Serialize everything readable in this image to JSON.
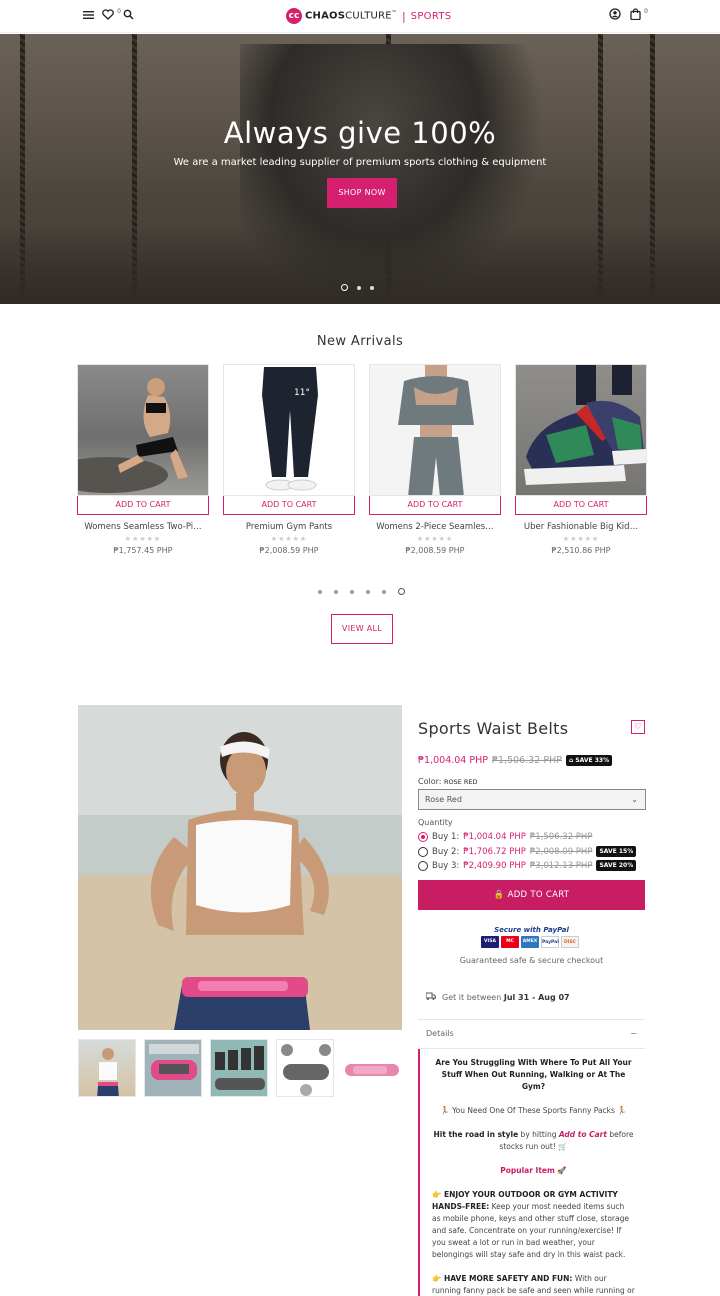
{
  "header": {
    "wishlist_count": "0",
    "cart_count": "0",
    "logo_bold": "CHAOS",
    "logo_light": "CULTURE",
    "logo_tm": "™",
    "logo_section": "SPORTS"
  },
  "hero": {
    "title": "Always give 100%",
    "subtitle": "We are a market leading supplier of premium sports clothing & equipment",
    "button": "SHOP NOW"
  },
  "new_arrivals": {
    "title": "New Arrivals",
    "products": [
      {
        "name": "Womens Seamless Two-Pi…",
        "price": "₱1,757.45 PHP",
        "button": "ADD TO CART",
        "stars": "★★★★★"
      },
      {
        "name": "Premium Gym Pants",
        "price": "₱2,008.59 PHP",
        "button": "ADD TO CART",
        "stars": "★★★★★"
      },
      {
        "name": "Womens 2-Piece Seamles…",
        "price": "₱2,008.59 PHP",
        "button": "ADD TO CART",
        "stars": "★★★★★"
      },
      {
        "name": "Uber Fashionable Big Kid…",
        "price": "₱2,510.86 PHP",
        "button": "ADD TO CART",
        "stars": "★★★★★"
      }
    ],
    "view_all": "VIEW ALL"
  },
  "product": {
    "title": "Sports Waist Belts",
    "price": "₱1,004.04 PHP",
    "compare_price": "₱1,506.32 PHP",
    "save_badge": "SAVE 33%",
    "color_label": "Color:",
    "color_value": "ROSE RED",
    "color_selected": "Rose Red",
    "quantity_label": "Quantity",
    "quantity_options": [
      {
        "label": "Buy 1:",
        "price": "₱1,004.04 PHP",
        "compare": "₱1,506.32 PHP",
        "badge": ""
      },
      {
        "label": "Buy 2:",
        "price": "₱1,706.72 PHP",
        "compare": "₱2,008.09 PHP",
        "badge": "SAVE 15%"
      },
      {
        "label": "Buy 3:",
        "price": "₱2,409.90 PHP",
        "compare": "₱3,012.13 PHP",
        "badge": "SAVE 20%"
      }
    ],
    "add_to_cart": "ADD TO CART",
    "secure_text": "Secure with",
    "paypal": "PayPal",
    "payment_cards": [
      "VISA",
      "MC",
      "AMEX",
      "PayPal",
      "DISC"
    ],
    "guarantee": "Guaranteed safe & secure checkout",
    "delivery_prefix": "Get it between",
    "delivery_dates": "Jul 31 - Aug 07",
    "details_label": "Details",
    "details": {
      "q1": "Are You Struggling With Where To Put All Your Stuff When Out Running, Walking or At The Gym?",
      "q2": "🏃 You Need One Of These Sports Fanny Packs 🏃",
      "q3_a": "Hit the road in style",
      "q3_b": " by hitting ",
      "q3_c": "Add to Cart",
      "q3_d": " before stocks run out! 🛒",
      "popular": "Popular Item 🚀",
      "f1_title": "👉 ENJOY YOUR OUTDOOR OR GYM ACTIVITY HANDS-FREE:",
      "f1_body": " Keep your most needed items such as mobile phone, keys and other stuff close, storage and safe. Concentrate on your running/exercise! If you sweat a lot or run in bad weather, your belongings will stay safe and dry in this waist pack.",
      "f2_title": "👉 HAVE MORE SAFETY AND FUN:",
      "f2_body": " With our running fanny pack be safe and seen while running or walking at night or during bad weather with this running bands"
    }
  },
  "colors": {
    "accent": "#d6206f",
    "accent_dark": "#c81d63"
  }
}
